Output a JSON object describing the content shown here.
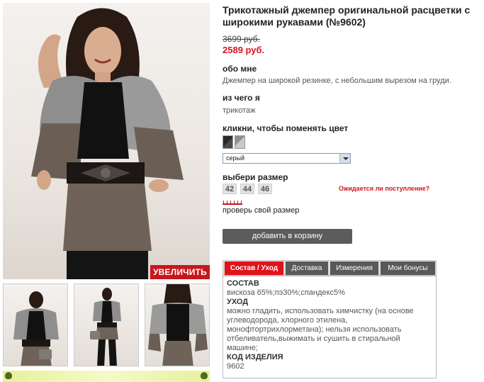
{
  "product": {
    "title": "Трикотажный джемпер оригинальной расцветки с широкими рукавами (№9602)",
    "old_price": "3699 руб.",
    "new_price": "2589 руб."
  },
  "about": {
    "heading": "обо мне",
    "text": "Джемпер на широкой резинке, с небольшим вырезом на груди."
  },
  "material": {
    "heading": "из чего я",
    "text": "трикотаж"
  },
  "color": {
    "heading": "кликни, чтобы поменять цвет",
    "selected": "серый",
    "swatch_colors": [
      "#2a2a2a",
      "#a8a8a8"
    ]
  },
  "size": {
    "heading": "выбери размер",
    "options": [
      "42",
      "44",
      "46"
    ],
    "wait_link": "Ожидается ли поступление?",
    "check_link": "проверь свой размер"
  },
  "cart": {
    "label": "добавить в корзину"
  },
  "gallery": {
    "zoom_label": "УВЕЛИЧИТЬ"
  },
  "tabs": [
    "Состав / Уход",
    "Доставка",
    "Измерения",
    "Мои бонусы"
  ],
  "details": {
    "composition_heading": "СОСТАВ",
    "composition": "вискоза 65%;пэ30%;спандекс5%",
    "care_heading": "УХОД",
    "care": "можно гладить, использовать химчистку (на основе углеводорода, хлорного этилена, монофтортрихлорметана); нельзя использовать отбеливатель,выжимать и сушить в стиральной машине;",
    "code_heading": "КОД ИЗДЕЛИЯ",
    "code": "9602"
  },
  "colors": {
    "accent_red": "#e0121b",
    "button_gray": "#5c5c5c",
    "tab_gray": "#595959"
  }
}
